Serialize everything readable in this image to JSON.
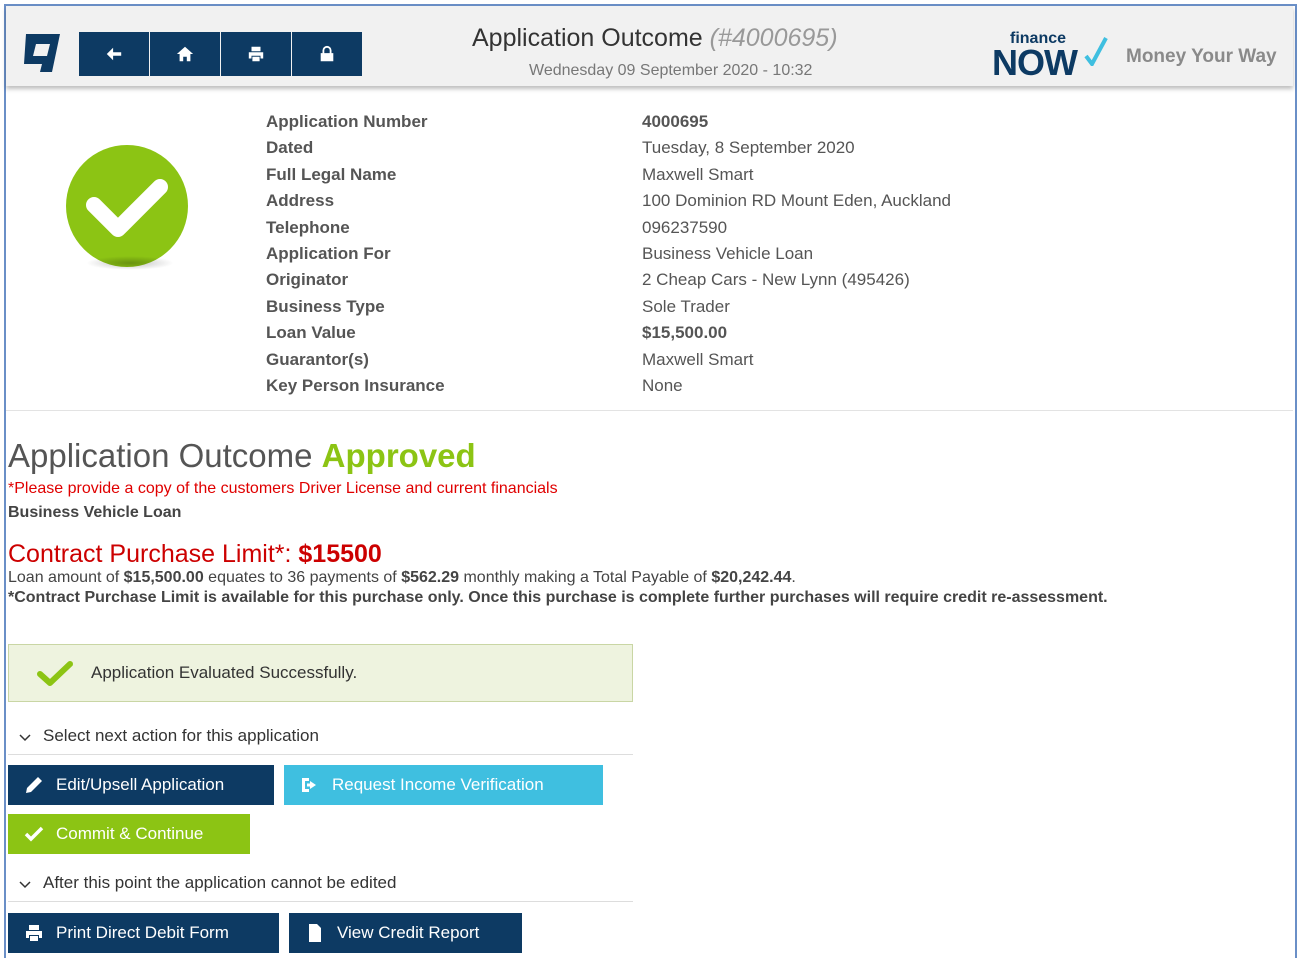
{
  "header": {
    "title": "Application Outcome",
    "app_number": "(#4000695)",
    "datetime": "Wednesday 09 September 2020 - 10:32",
    "brand_small": "finance",
    "brand_big": "NOW",
    "tagline": "Money Your Way",
    "accent_color": "#0d3a63"
  },
  "nav": {
    "buttons": [
      "back-arrow-icon",
      "home-icon",
      "print-icon",
      "lock-icon"
    ]
  },
  "summary": {
    "rows": [
      {
        "label": "Application Number",
        "value": "4000695",
        "bold": true
      },
      {
        "label": "Dated",
        "value": "Tuesday, 8 September 2020",
        "bold": false
      },
      {
        "label": "Full Legal Name",
        "value": "Maxwell Smart",
        "bold": false
      },
      {
        "label": "Address",
        "value": "100 Dominion RD Mount Eden, Auckland",
        "bold": false
      },
      {
        "label": "Telephone",
        "value": "096237590",
        "bold": false
      },
      {
        "label": "Application For",
        "value": "Business Vehicle Loan",
        "bold": false
      },
      {
        "label": "Originator",
        "value": "2 Cheap Cars - New Lynn (495426)",
        "bold": false
      },
      {
        "label": "Business Type",
        "value": "Sole Trader",
        "bold": false
      },
      {
        "label": "Loan Value",
        "value": "$15,500.00",
        "bold": true
      },
      {
        "label": "Guarantor(s)",
        "value": "Maxwell Smart",
        "bold": false
      },
      {
        "label": "Key Person Insurance",
        "value": "None",
        "bold": false
      }
    ]
  },
  "outcome": {
    "title": "Application Outcome",
    "status": "Approved",
    "status_color": "#8cc414",
    "notice": "*Please provide a copy of the customers Driver License and current financials",
    "loan_type": "Business Vehicle Loan",
    "cpl_label": "Contract Purchase Limit*:",
    "cpl_value": "$15500",
    "loan_line": {
      "p1": "Loan amount of ",
      "amount": "$15,500.00",
      "p2": " equates to 36 payments of ",
      "payment": "$562.29",
      "p3": " monthly making a Total Payable of ",
      "total": "$20,242.44",
      "p4": "."
    },
    "cpl_note": "*Contract Purchase Limit is available for this purchase only. Once this purchase is complete further purchases will require credit re-assessment."
  },
  "success_message": "Application Evaluated Successfully.",
  "actions": {
    "section1": "Select next action for this application",
    "edit_upsell": "Edit/Upsell Application",
    "request_income": "Request Income Verification",
    "commit_continue": "Commit & Continue",
    "section2": "After this point the application cannot be edited",
    "print_dd": "Print Direct Debit Form",
    "view_credit": "View Credit Report"
  }
}
